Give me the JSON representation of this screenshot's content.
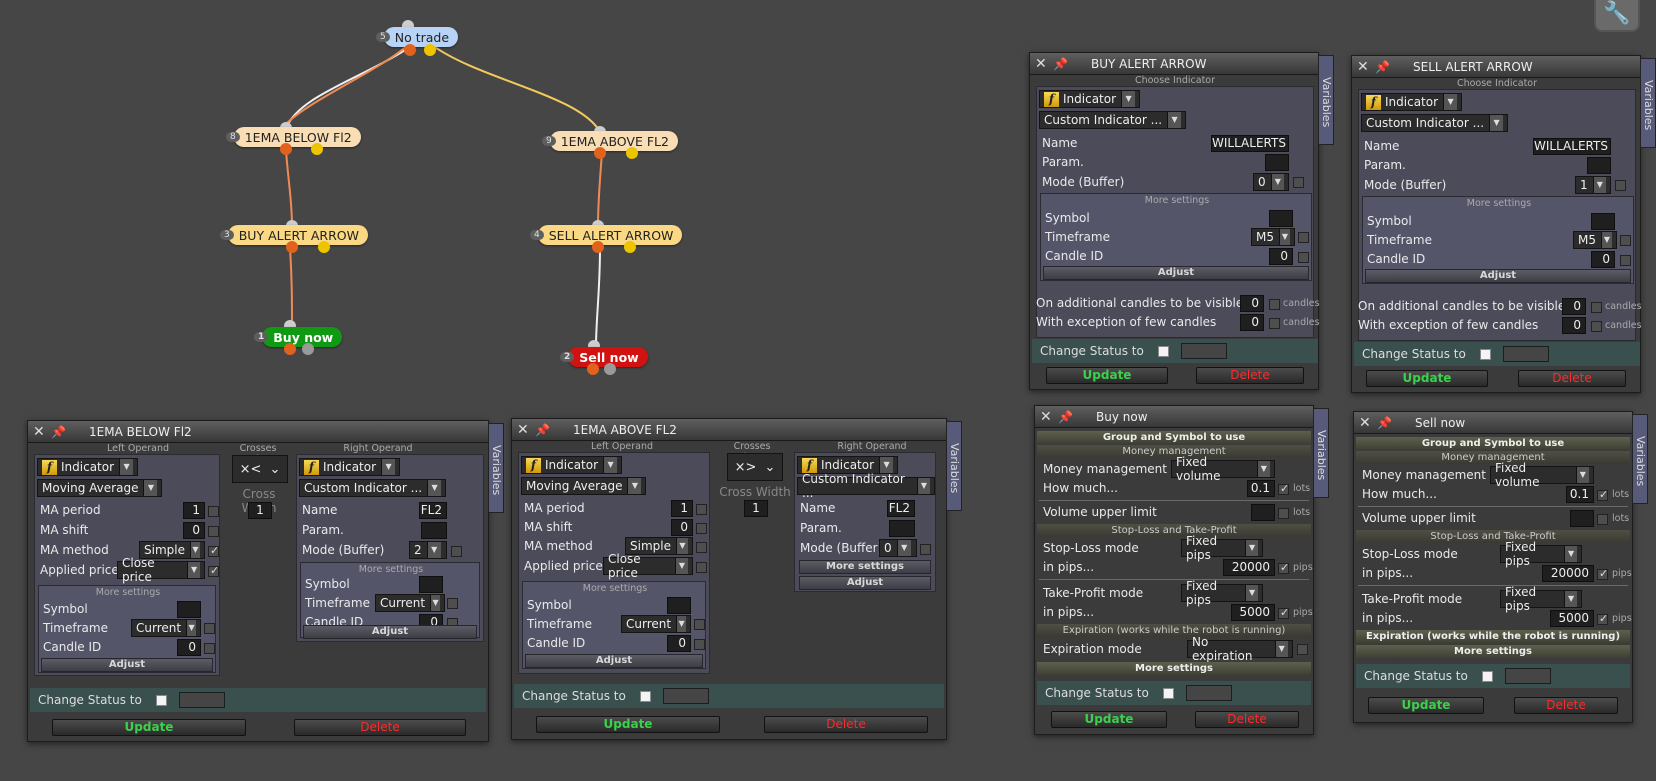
{
  "colors": {
    "background": "#464646",
    "update": "#3bd14a",
    "delete": "#ff2a2a",
    "start": "#b7d3f6",
    "condition": "#f9ddb4",
    "action": "#fad884",
    "buy": "#109a14",
    "sell": "#d21111"
  },
  "graph": {
    "nodes": [
      {
        "num": "5",
        "label": "No trade"
      },
      {
        "num": "8",
        "label": "1EMA BELOW Fl2"
      },
      {
        "num": "9",
        "label": "1EMA ABOVE FL2"
      },
      {
        "num": "3",
        "label": "BUY ALERT ARROW"
      },
      {
        "num": "4",
        "label": "SELL ALERT ARROW"
      },
      {
        "num": "1",
        "label": "Buy now"
      },
      {
        "num": "2",
        "label": "Sell now"
      }
    ]
  },
  "common": {
    "variables": "Variables",
    "change_status": "Change Status to",
    "update": "Update",
    "delete": "Delete",
    "adjust": "Adjust",
    "more_settings": "More settings",
    "indicator": "Indicator",
    "left_operand": "Left Operand",
    "right_operand": "Right Operand",
    "cross_width": "Cross Width"
  },
  "p1": {
    "title": "1EMA BELOW Fl2",
    "crosses": "Crosses Below",
    "cross_sym": "×<",
    "cross_width_val": "1",
    "left": {
      "type": "Moving Average",
      "rows": [
        "MA period",
        "MA shift",
        "MA method",
        "Applied price"
      ],
      "vals": [
        "1",
        "0",
        "Simple",
        "Close price"
      ],
      "more": [
        "Symbol",
        "Timeframe",
        "Candle ID"
      ],
      "more_vals": [
        "",
        "Current",
        "0"
      ]
    },
    "right": {
      "type": "Custom Indicator ...",
      "rows": [
        "Name",
        "Param.",
        "Mode (Buffer)"
      ],
      "vals": [
        "FL2",
        "",
        "2"
      ],
      "more": [
        "Symbol",
        "Timeframe",
        "Candle ID"
      ],
      "more_vals": [
        "",
        "Current",
        "0"
      ]
    }
  },
  "p2": {
    "title": "1EMA ABOVE FL2",
    "crosses": "Crosses Above",
    "cross_sym": "×>",
    "cross_width_val": "1",
    "left": {
      "type": "Moving Average",
      "rows": [
        "MA period",
        "MA shift",
        "MA method",
        "Applied price"
      ],
      "vals": [
        "1",
        "0",
        "Simple",
        "Close price"
      ],
      "more": [
        "Symbol",
        "Timeframe",
        "Candle ID"
      ],
      "more_vals": [
        "",
        "Current",
        "0"
      ]
    },
    "right": {
      "type": "Custom Indicator ...",
      "rows": [
        "Name",
        "Param.",
        "Mode (Buffer)"
      ],
      "vals": [
        "FL2",
        "",
        "0"
      ]
    }
  },
  "p3": {
    "title": "BUY ALERT ARROW",
    "choose": "Choose Indicator",
    "type": "Custom Indicator ...",
    "rows": [
      "Name",
      "Param.",
      "Mode (Buffer)"
    ],
    "vals": [
      "WILLALERTS",
      "",
      "0"
    ],
    "more": [
      "Symbol",
      "Timeframe",
      "Candle ID"
    ],
    "more_vals": [
      "",
      "M5",
      "0"
    ],
    "extra": [
      "On additional candles to be visible",
      "With exception of few candles"
    ],
    "extra_vals": [
      "0",
      "0"
    ],
    "candles": "candles"
  },
  "p4": {
    "title": "SELL ALERT ARROW",
    "choose": "Choose Indicator",
    "type": "Custom Indicator ...",
    "rows": [
      "Name",
      "Param.",
      "Mode (Buffer)"
    ],
    "vals": [
      "WILLALERTS",
      "",
      "1"
    ],
    "more": [
      "Symbol",
      "Timeframe",
      "Candle ID"
    ],
    "more_vals": [
      "",
      "M5",
      "0"
    ],
    "extra": [
      "On additional candles to be visible",
      "With exception of few candles"
    ],
    "extra_vals": [
      "0",
      "0"
    ],
    "candles": "candles"
  },
  "p5": {
    "title": "Buy now",
    "group": "Group and Symbol to use",
    "money": "Money management",
    "mm_label": "Money management",
    "mm_val": "Fixed volume",
    "how": "How much...",
    "how_val": "0.1",
    "lots": "lots",
    "vol": "Volume upper limit",
    "sltp": "Stop-Loss and Take-Profit",
    "sl": "Stop-Loss mode",
    "sl_val": "Fixed pips",
    "in_pips": "in pips...",
    "sl_pips": "20000",
    "pips": "pips",
    "tp": "Take-Profit mode",
    "tp_val": "Fixed pips",
    "tp_pips": "5000",
    "expiration": "Expiration (works while the robot is running)",
    "exp_mode": "Expiration mode",
    "exp_val": "No expiration"
  },
  "p6": {
    "title": "Sell now",
    "group": "Group and Symbol to use",
    "money": "Money management",
    "mm_label": "Money management",
    "mm_val": "Fixed volume",
    "how": "How much...",
    "how_val": "0.1",
    "lots": "lots",
    "vol": "Volume upper limit",
    "sltp": "Stop-Loss and Take-Profit",
    "sl": "Stop-Loss mode",
    "sl_val": "Fixed pips",
    "in_pips": "in pips...",
    "sl_pips": "20000",
    "pips": "pips",
    "tp": "Take-Profit mode",
    "tp_val": "Fixed pips",
    "tp_pips": "5000",
    "expiration": "Expiration (works while the robot is running)"
  },
  "icons": {
    "close": "close-icon",
    "pin": "pin-icon",
    "function": "function-icon",
    "tool": "wrench-icon"
  }
}
